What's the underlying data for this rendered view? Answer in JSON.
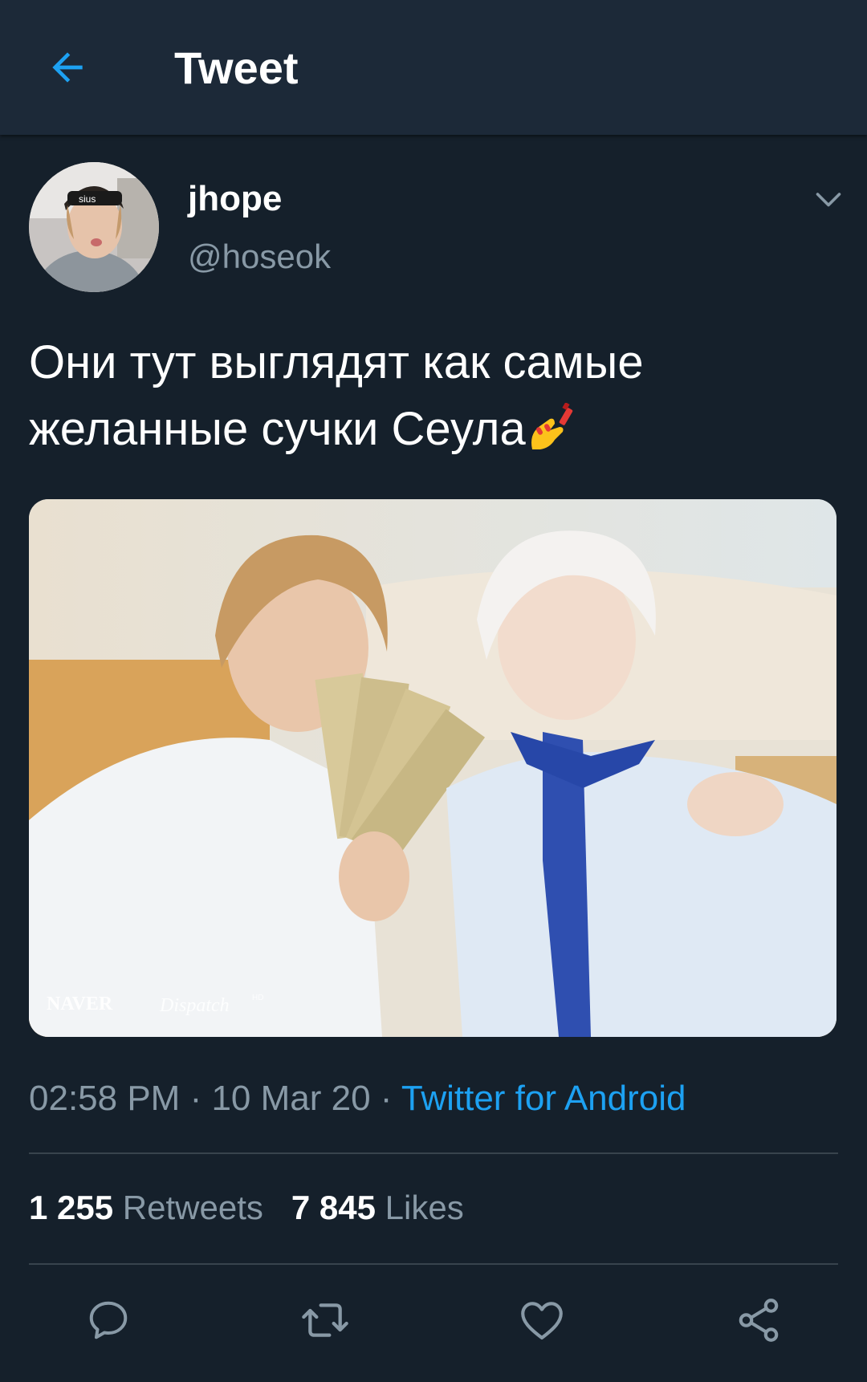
{
  "header": {
    "back_icon": "arrow-left-icon",
    "title": "Tweet",
    "accent": "#1da1f2"
  },
  "author": {
    "name": "jhope",
    "handle": "@hoseok",
    "menu_icon": "chevron-down-icon"
  },
  "tweet": {
    "text": "Они тут выглядят как самые желанные сучки Сеула",
    "emoji": "nail-polish-emoji",
    "media": {
      "watermark_left": "NAVER",
      "watermark_right": "Dispatch",
      "watermark_hd": "HD"
    }
  },
  "meta": {
    "time": "02:58 PM",
    "separator": " · ",
    "date": "10 Mar 20",
    "source": "Twitter for Android"
  },
  "stats": {
    "retweets_count": "1 255",
    "retweets_label": "Retweets",
    "likes_count": "7 845",
    "likes_label": "Likes"
  },
  "actions": {
    "reply_icon": "reply-icon",
    "retweet_icon": "retweet-icon",
    "like_icon": "heart-icon",
    "share_icon": "share-icon"
  },
  "colors": {
    "background": "#15202b",
    "header_bg": "#1c2938",
    "secondary_text": "#8899a6",
    "divider": "#38444d"
  }
}
